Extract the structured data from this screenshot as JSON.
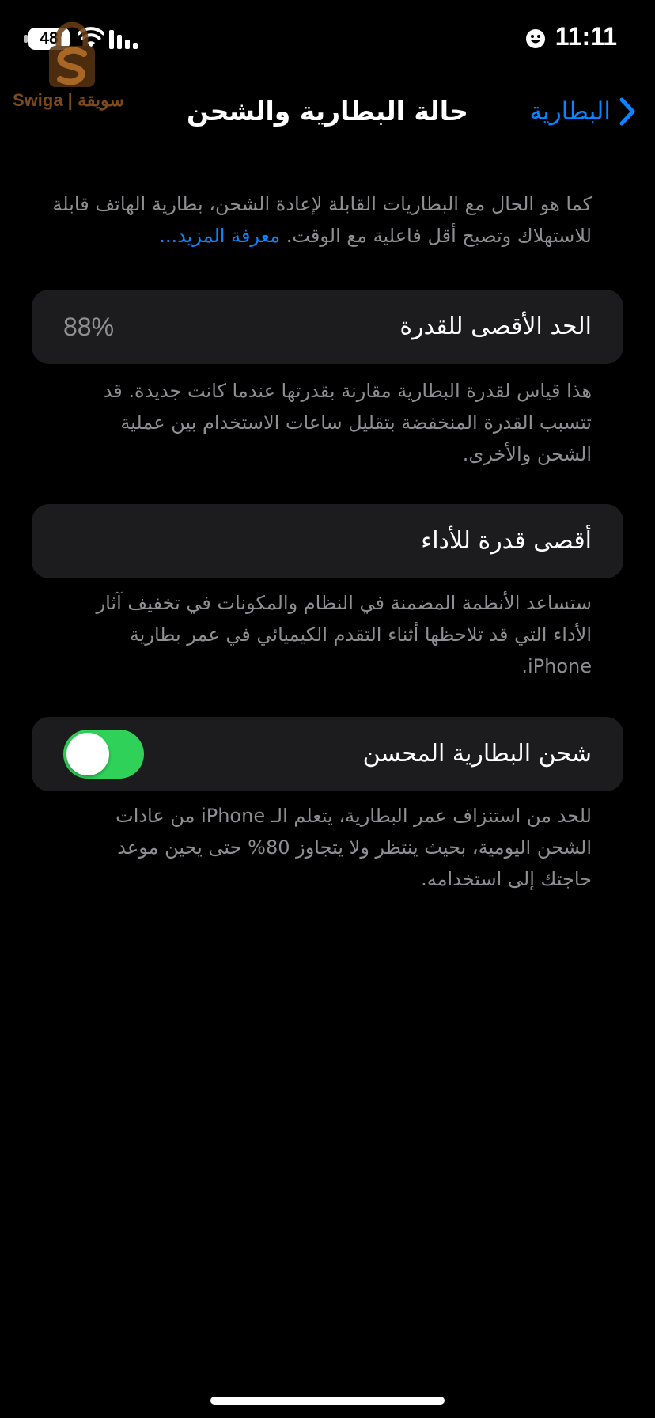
{
  "status_bar": {
    "time": "11:11",
    "battery_level": "48",
    "icons": [
      "battery-icon",
      "wifi-icon",
      "signal-icon",
      "face-icon"
    ]
  },
  "watermark": {
    "text": "Swiga | سويقة"
  },
  "nav": {
    "back_label": "البطارية",
    "title": "حالة البطارية والشحن"
  },
  "intro": {
    "text": "كما هو الحال مع البطاريات القابلة لإعادة الشحن، بطارية الهاتف قابلة للاستهلاك وتصبح أقل فاعلية مع الوقت.",
    "link": "معرفة المزيد..."
  },
  "maximum_capacity": {
    "label": "الحد الأقصى للقدرة",
    "value": "88%",
    "footnote": "هذا قياس لقدرة البطارية مقارنة بقدرتها عندما كانت جديدة. قد تتسبب القدرة المنخفضة بتقليل ساعات الاستخدام بين عملية الشحن والأخرى."
  },
  "peak_performance": {
    "label": "أقصى قدرة للأداء",
    "footnote": "ستساعد الأنظمة المضمنة في النظام والمكونات في تخفيف آثار الأداء التي قد تلاحظها أثناء التقدم الكيميائي في عمر بطارية iPhone."
  },
  "optimized_charging": {
    "label": "شحن البطارية المحسن",
    "enabled": true,
    "footnote": "للحد من استنزاف عمر البطارية، يتعلم الـ iPhone من عادات الشحن اليومية، بحيث ينتظر ولا يتجاوز 80% حتى يحين موعد حاجتك إلى استخدامه."
  },
  "colors": {
    "background": "#000000",
    "card": "#1c1c1e",
    "accent": "#0a84ff",
    "toggle_on": "#30d158",
    "secondary_text": "#8e8e93"
  }
}
